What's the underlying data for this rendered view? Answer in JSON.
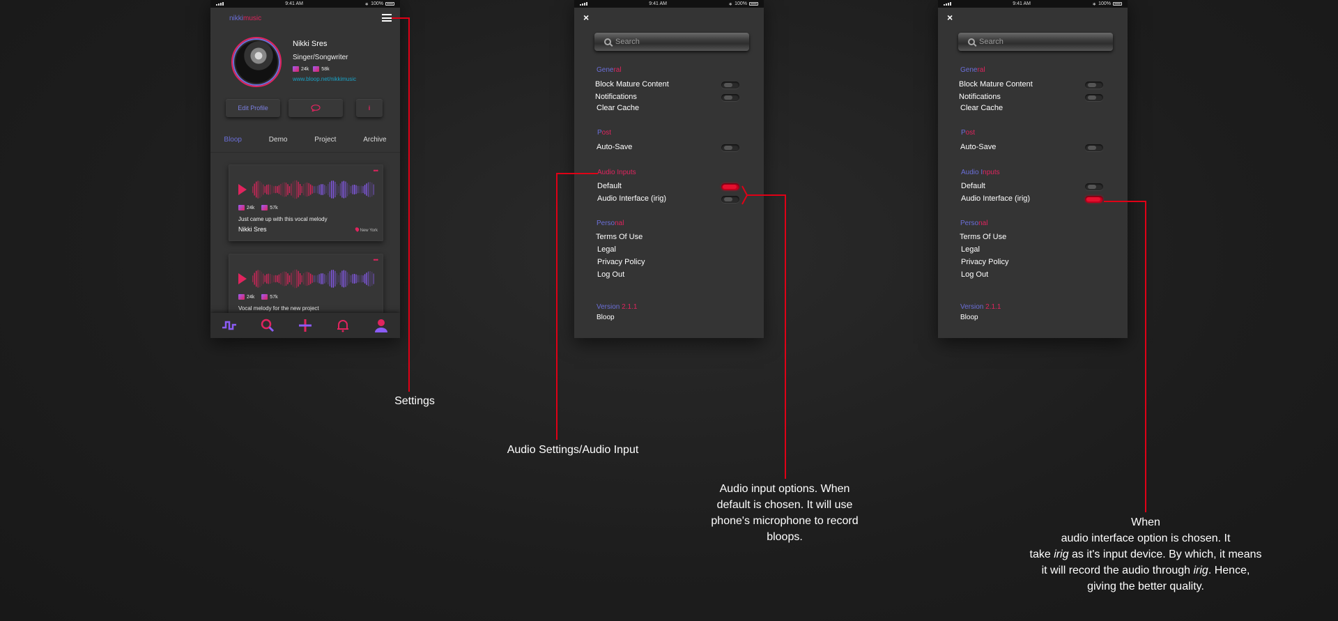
{
  "status_bar": {
    "time": "9:41 AM",
    "battery": "100%"
  },
  "profile_screen": {
    "logo": {
      "part1": "nikki",
      "part2": "music"
    },
    "name": "Nikki Sres",
    "role": "Singer/Songwriter",
    "likes": "24k",
    "listens": "58k",
    "link": "www.bloop.net/nikkimusic",
    "edit_profile_label": "Edit Profile",
    "info_label": "i",
    "tabs": [
      "Bloop",
      "Demo",
      "Project",
      "Archive"
    ],
    "posts": [
      {
        "likes": "24k",
        "listens": "57k",
        "caption": "Just came up with this vocal melody",
        "author": "Nikki Sres",
        "location": "New York"
      },
      {
        "likes": "24k",
        "listens": "57k",
        "caption": "Vocal melody for  the new project"
      }
    ],
    "bottom_nav": [
      "home-wave",
      "search",
      "add",
      "notifications",
      "profile"
    ]
  },
  "settings_common": {
    "close_label": "×",
    "search_placeholder": "Search",
    "sections": {
      "general": {
        "a": "Gene",
        "b": "ral"
      },
      "post": {
        "a": "P",
        "b": "ost"
      },
      "audio": {
        "a": "Audio ",
        "b": "Inputs"
      },
      "personal": {
        "a": "Perso",
        "b": "nal"
      }
    },
    "items": {
      "block_mature": "Block Mature Content",
      "notifications": "Notifications",
      "clear_cache": "Clear Cache",
      "auto_save": "Auto-Save",
      "default": "Default",
      "audio_interface": "Audio Interface (irig)",
      "terms": "Terms Of Use",
      "legal": "Legal",
      "privacy": "Privacy Policy",
      "logout": "Log Out"
    },
    "version": {
      "label": "Version ",
      "number": "2.1.1"
    },
    "app_name": "Bloop"
  },
  "settings_screen_1": {
    "audio_selected": "default",
    "audio_section": {
      "a": "Audio I",
      "b": "nputs"
    }
  },
  "settings_screen_2": {
    "audio_selected": "audio_interface",
    "audio_section": {
      "a": "Audio I",
      "b": "nputs"
    }
  },
  "annotations": {
    "settings": "Settings",
    "audio_settings": "Audio Settings/Audio Input",
    "audio_options": [
      "Audio input options. When",
      "default is chosen. It will use",
      "phone's microphone to record",
      "bloops."
    ],
    "interface_note": {
      "line1": "When",
      "line2": "audio interface option is chosen. It",
      "line3_pre": "take ",
      "line3_em": "irig",
      "line3_post": " as it's input device. By which, it means",
      "line4_pre": "it will record the audio through ",
      "line4_em": "irig",
      "line4_post": ". Hence,",
      "line5": "giving the better quality."
    }
  },
  "colors": {
    "accent_blue": "#6b6fd8",
    "accent_red": "#e0245e",
    "annotation_line": "#e00016",
    "toggle_on": "#c4001f"
  }
}
